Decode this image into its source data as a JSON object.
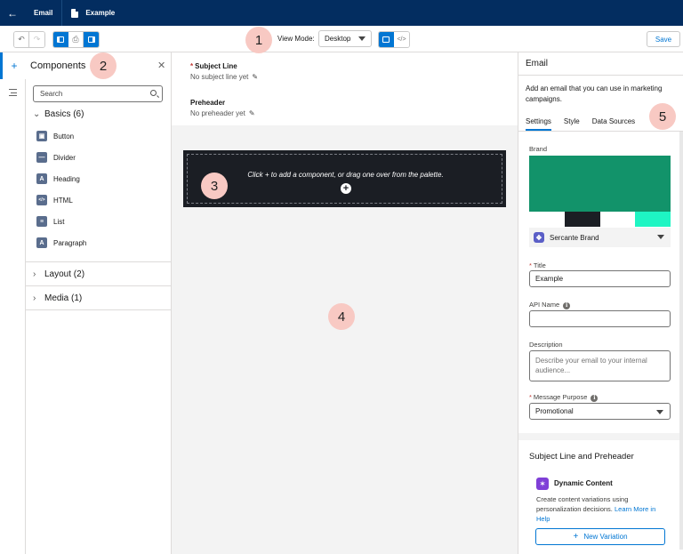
{
  "header": {
    "app_label": "Email",
    "record_label": "Example"
  },
  "toolbar": {
    "view_mode_label": "View Mode:",
    "view_mode_value": "Desktop",
    "save_label": "Save"
  },
  "annotations": [
    "1",
    "2",
    "3",
    "4",
    "5"
  ],
  "components_panel": {
    "title": "Components",
    "search_placeholder": "Search",
    "basics_label": "Basics (6)",
    "basics_items": [
      {
        "label": "Button",
        "icon": "button-icon"
      },
      {
        "label": "Divider",
        "icon": "divider-icon"
      },
      {
        "label": "Heading",
        "icon": "heading-icon"
      },
      {
        "label": "HTML",
        "icon": "html-icon"
      },
      {
        "label": "List",
        "icon": "list-icon"
      },
      {
        "label": "Paragraph",
        "icon": "paragraph-icon"
      }
    ],
    "layout_label": "Layout (2)",
    "media_label": "Media (1)"
  },
  "canvas": {
    "subject_label": "Subject Line",
    "subject_value": "No subject line yet",
    "preheader_label": "Preheader",
    "preheader_value": "No preheader yet",
    "dropzone_text": "Click + to add a component, or drag one over from the palette."
  },
  "properties_panel": {
    "title": "Email",
    "description": "Add an email that you can use in marketing campaigns.",
    "tabs": [
      "Settings",
      "Style",
      "Data Sources"
    ],
    "brand_label": "Brand",
    "brand_colors": {
      "main": "#12936a",
      "swatches": [
        "#ffffff",
        "#1b1e24",
        "#ffffff",
        "#1ef5c3"
      ]
    },
    "brand_value": "Sercante Brand",
    "title_label": "Title",
    "title_value": "Example",
    "api_name_label": "API Name",
    "api_name_value": "",
    "description_label": "Description",
    "description_placeholder": "Describe your email to your internal audience...",
    "message_purpose_label": "Message Purpose",
    "message_purpose_value": "Promotional",
    "slp_title": "Subject Line and Preheader",
    "dynamic_content_title": "Dynamic Content",
    "dynamic_content_desc": "Create content variations using personalization decisions.",
    "dynamic_content_link": "Learn More in Help",
    "new_variation_label": "New Variation"
  }
}
